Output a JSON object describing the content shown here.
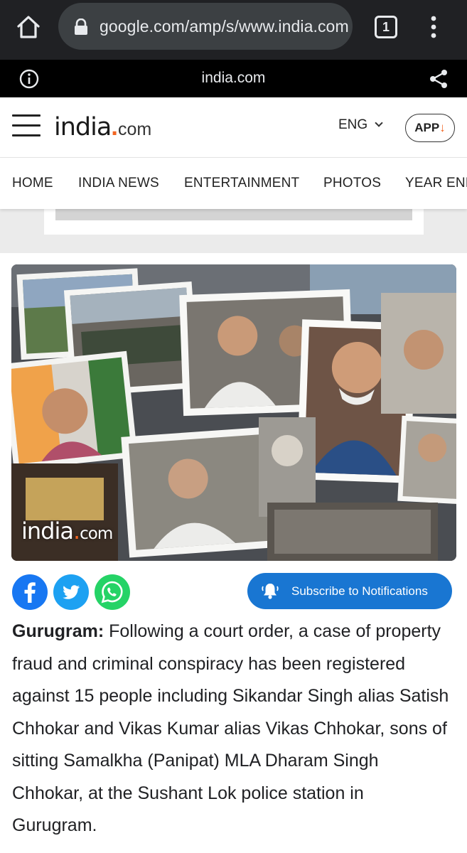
{
  "browser": {
    "url": "google.com/amp/s/www.india.com",
    "tab_count": "1",
    "amp_domain": "india.com"
  },
  "site": {
    "logo_main": "india",
    "logo_dot": ".",
    "logo_suffix": "com",
    "language": "ENG",
    "app_label": "APP",
    "app_arrow": "↓",
    "brand_accent": "#f26522"
  },
  "nav": {
    "items": [
      {
        "label": "HOME"
      },
      {
        "label": "INDIA NEWS"
      },
      {
        "label": "ENTERTAINMENT"
      },
      {
        "label": "PHOTOS"
      },
      {
        "label": "YEAR END"
      }
    ]
  },
  "hero": {
    "watermark_main": "india",
    "watermark_dot": ".",
    "watermark_suffix": "com"
  },
  "share": {
    "facebook_color": "#1877f2",
    "twitter_color": "#1da1f2",
    "whatsapp_color": "#25d366"
  },
  "subscribe": {
    "label": "Subscribe to Notifications",
    "color": "#1976d2"
  },
  "article": {
    "dateline": "Gurugram:",
    "body": " Following a court order, a case of property fraud and criminal conspiracy has been registered against 15 people including Sikandar Singh alias Satish Chhokar and Vikas Kumar alias Vikas Chhokar, sons of sitting Samalkha (Panipat) MLA Dharam Singh Chhokar, at the Sushant Lok police station in Gurugram."
  }
}
